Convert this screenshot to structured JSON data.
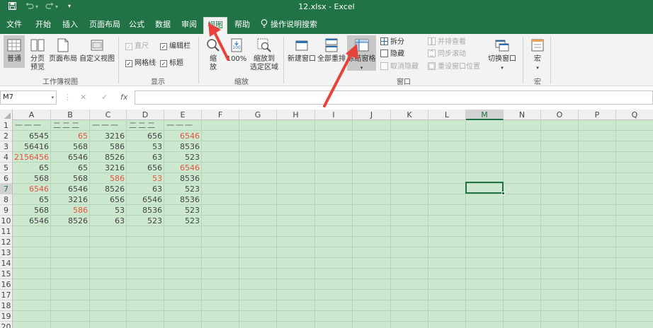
{
  "titlebar": {
    "save_icon": "save-icon",
    "undo_icon": "undo-icon",
    "redo_icon": "redo-icon",
    "title": "12.xlsx  -  Excel"
  },
  "tabs": [
    {
      "label": "文件"
    },
    {
      "label": "开始"
    },
    {
      "label": "插入"
    },
    {
      "label": "页面布局"
    },
    {
      "label": "公式"
    },
    {
      "label": "数据"
    },
    {
      "label": "审阅"
    },
    {
      "label": "视图",
      "active": true
    },
    {
      "label": "帮助"
    },
    {
      "label": "操作说明搜索",
      "icon": "lightbulb-icon"
    }
  ],
  "ribbon": {
    "workbook_views": {
      "label": "工作簿视图",
      "normal": "普通",
      "page_break_1": "分页",
      "page_break_2": "预览",
      "page_layout": "页面布局",
      "custom_views": "自定义视图"
    },
    "show": {
      "label": "显示",
      "ruler": "直尺",
      "formula_bar": "编辑栏",
      "gridlines": "网格线",
      "headings": "标题"
    },
    "zoom": {
      "label": "缩放",
      "zoom_1": "缩",
      "zoom_2": "放",
      "zoom_100": "100%",
      "zoom_sel_1": "缩放到",
      "zoom_sel_2": "选定区域"
    },
    "window": {
      "label": "窗口",
      "new_window": "新建窗口",
      "arrange_all": "全部重排",
      "freeze_panes": "冻结窗格",
      "split": "拆分",
      "hide": "隐藏",
      "unhide": "取消隐藏",
      "side_by_side": "并排查看",
      "sync_scroll": "同步滚动",
      "reset_pos": "重设窗口位置",
      "switch_windows": "切换窗口"
    },
    "macros": {
      "label": "宏",
      "macros": "宏"
    }
  },
  "formula_bar": {
    "name_box": "M7",
    "cancel": "✕",
    "enter": "✓",
    "fx": "fx",
    "formula": ""
  },
  "columns": [
    "A",
    "B",
    "C",
    "D",
    "E",
    "F",
    "G",
    "H",
    "I",
    "J",
    "K",
    "L",
    "M",
    "N",
    "O",
    "P",
    "Q"
  ],
  "rows": [
    "1",
    "2",
    "3",
    "4",
    "5",
    "6",
    "7",
    "8",
    "9",
    "10",
    "11",
    "12",
    "13",
    "14",
    "15",
    "16",
    "17",
    "18",
    "19",
    "20"
  ],
  "selected_cell": "M7",
  "sheet": {
    "header_row": [
      "一一一",
      "二二二",
      "一一一",
      "二二二",
      "一一一"
    ],
    "data": [
      [
        "6545",
        "65",
        "3216",
        "656",
        "6546"
      ],
      [
        "56416",
        "568",
        "586",
        "53",
        "8536"
      ],
      [
        "2156456",
        "6546",
        "8526",
        "63",
        "523"
      ],
      [
        "65",
        "65",
        "3216",
        "656",
        "6546"
      ],
      [
        "568",
        "568",
        "586",
        "53",
        "8536"
      ],
      [
        "6546",
        "6546",
        "8526",
        "63",
        "523"
      ],
      [
        "65",
        "3216",
        "656",
        "6546",
        "8536"
      ],
      [
        "568",
        "586",
        "53",
        "8536",
        "523"
      ],
      [
        "6546",
        "8526",
        "63",
        "523",
        "523"
      ]
    ]
  },
  "colors": {
    "accent": "#217346",
    "sheet_bg": "#cce8cf",
    "highlight_text": "#e8533f",
    "arrow": "#e8403a"
  }
}
